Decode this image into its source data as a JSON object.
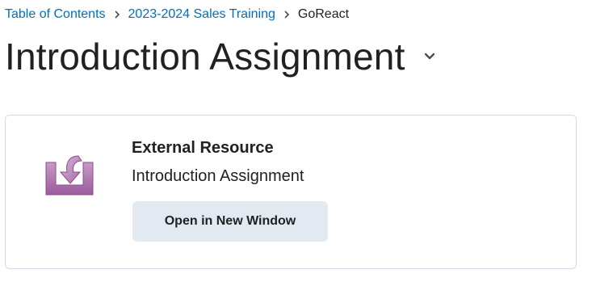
{
  "breadcrumb": {
    "items": [
      {
        "label": "Table of Contents"
      },
      {
        "label": "2023-2024 Sales Training"
      }
    ],
    "current": "GoReact",
    "separator": "›"
  },
  "page": {
    "title": "Introduction Assignment"
  },
  "resource": {
    "type_label": "External Resource",
    "name": "Introduction Assignment",
    "open_button_label": "Open in New Window",
    "icon": "external-resource-icon",
    "icon_color": "#a66aa7"
  },
  "colors": {
    "link": "#006fbf",
    "text": "#202122",
    "button_bg": "#e3e9f1",
    "card_border": "#d3d9e3"
  }
}
